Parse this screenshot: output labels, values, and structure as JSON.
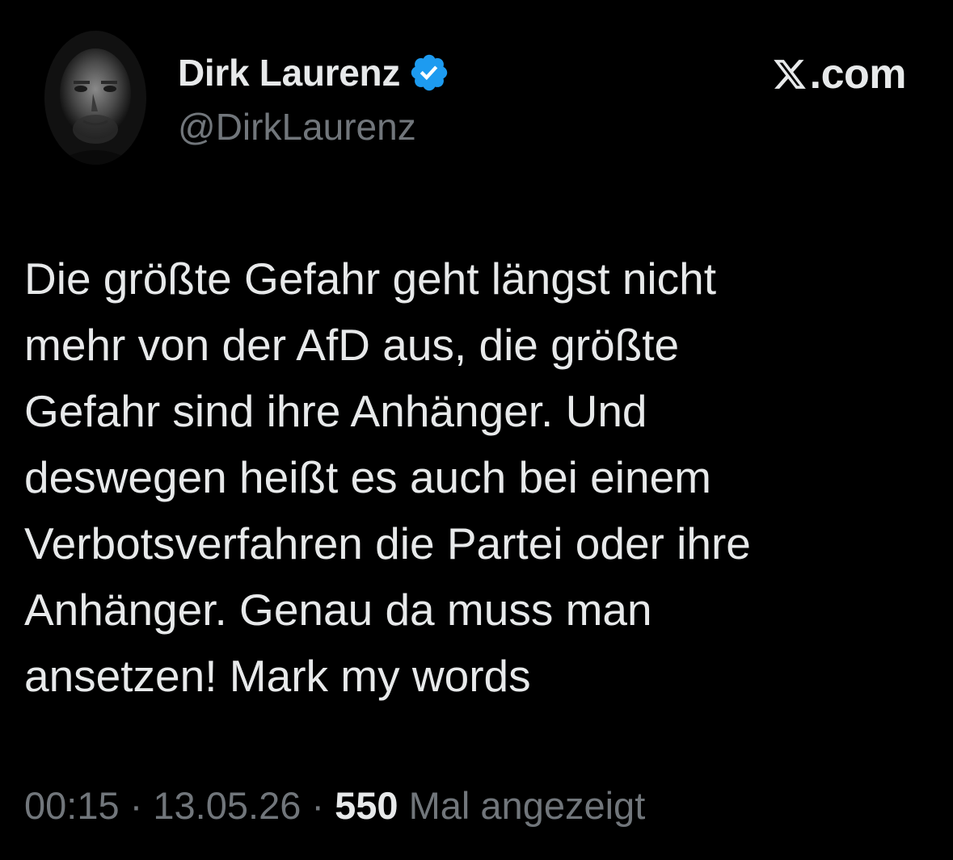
{
  "author": {
    "display_name": "Dirk Laurenz",
    "handle": "@DirkLaurenz",
    "verified": true,
    "verified_badge_color": "#1d9bf0",
    "avatar_icon": "profile-photo-bw"
  },
  "brand": {
    "icon": "x-logo-icon",
    "text": ".com"
  },
  "tweet": {
    "lines": [
      "Die größte Gefahr geht längst nicht",
      "mehr von der AfD aus, die größte",
      "Gefahr sind ihre Anhänger. Und",
      "deswegen heißt es auch bei einem",
      "Verbotsverfahren die Partei oder ihre",
      "Anhänger. Genau da muss man",
      "ansetzen! Mark my words"
    ]
  },
  "meta": {
    "time": "00:15",
    "separator": " · ",
    "date": "13.05.26",
    "views_count": "550",
    "views_label": " Mal angezeigt"
  },
  "colors": {
    "background": "#000000",
    "primary_text": "#e7e9ea",
    "secondary_text": "#71767b"
  }
}
